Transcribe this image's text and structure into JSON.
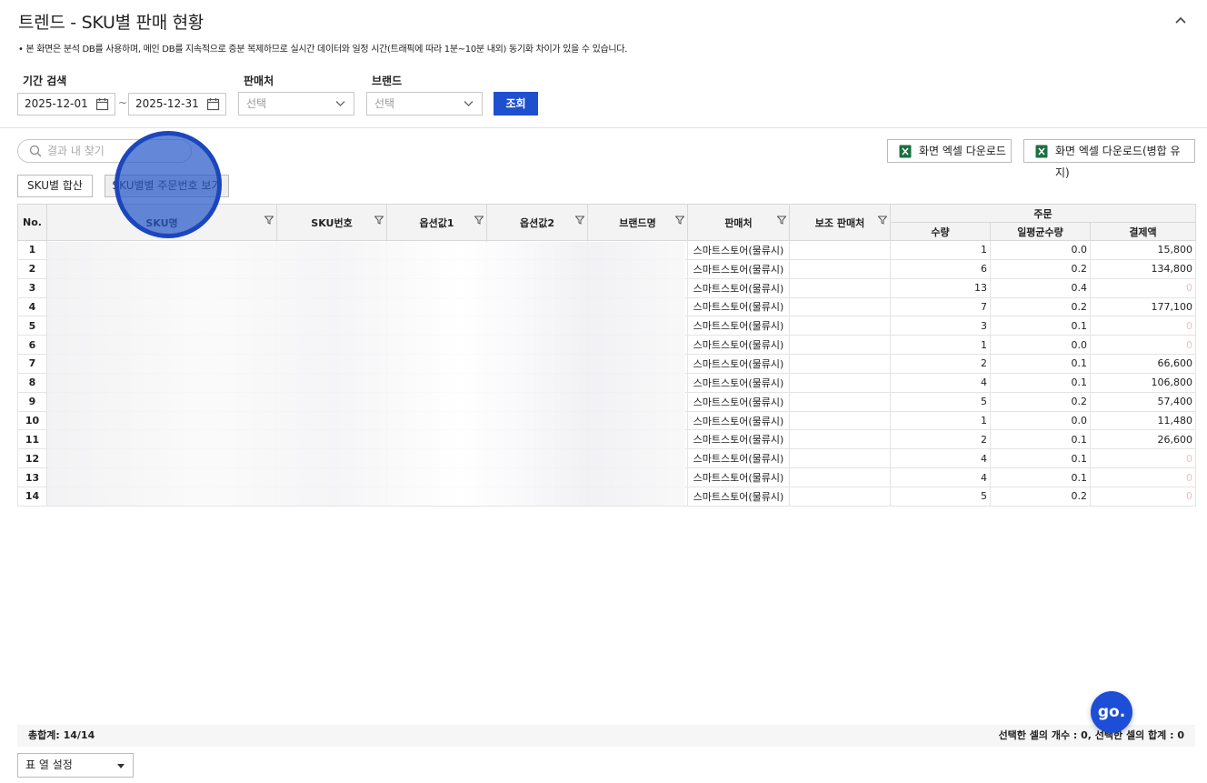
{
  "page": {
    "title": "트렌드 - SKU별 판매 현황",
    "notice": "• 본 화면은 분석 DB를 사용하며, 메인 DB를 지속적으로 증분 복제하므로 실시간 데이터와 일정 시간(트래픽에 따라 1분~10분 내외) 동기화 차이가 있을 수 있습니다."
  },
  "filters": {
    "period_label": "기간 검색",
    "start_date": "2025-12-01",
    "tilde": "~",
    "end_date": "2025-12-31",
    "seller_label": "판매처",
    "seller_value": "선택",
    "brand_label": "브랜드",
    "brand_value": "선택",
    "search_button": "조회"
  },
  "toolbar": {
    "search_placeholder": "결과 내 찾기",
    "excel_download": "화면 엑셀 다운로드",
    "excel_download_merged": "화면 엑셀 다운로드(병합 유지)",
    "view_sum": "SKU별 합산",
    "view_order": "SKU별별 주문번호 보기"
  },
  "table": {
    "headers": {
      "no": "No.",
      "sku_name": "SKU명",
      "sku_no": "SKU번호",
      "option1": "옵션값1",
      "option2": "옵션값2",
      "brand": "브랜드명",
      "seller": "판매처",
      "sub_seller": "보조 판매처",
      "order_group": "주문",
      "qty": "수량",
      "avg_qty": "일평균수량",
      "amount": "결제액"
    },
    "rows": [
      {
        "no": "1",
        "seller": "스마트스토어(물류시)",
        "qty": "1",
        "avg": "0.0",
        "amount": "15,800"
      },
      {
        "no": "2",
        "seller": "스마트스토어(물류시)",
        "qty": "6",
        "avg": "0.2",
        "amount": "134,800"
      },
      {
        "no": "3",
        "seller": "스마트스토어(물류시)",
        "qty": "13",
        "avg": "0.4",
        "amount": "0"
      },
      {
        "no": "4",
        "seller": "스마트스토어(물류시)",
        "qty": "7",
        "avg": "0.2",
        "amount": "177,100"
      },
      {
        "no": "5",
        "seller": "스마트스토어(물류시)",
        "qty": "3",
        "avg": "0.1",
        "amount": "0"
      },
      {
        "no": "6",
        "seller": "스마트스토어(물류시)",
        "qty": "1",
        "avg": "0.0",
        "amount": "0"
      },
      {
        "no": "7",
        "seller": "스마트스토어(물류시)",
        "qty": "2",
        "avg": "0.1",
        "amount": "66,600"
      },
      {
        "no": "8",
        "seller": "스마트스토어(물류시)",
        "qty": "4",
        "avg": "0.1",
        "amount": "106,800"
      },
      {
        "no": "9",
        "seller": "스마트스토어(물류시)",
        "qty": "5",
        "avg": "0.2",
        "amount": "57,400"
      },
      {
        "no": "10",
        "seller": "스마트스토어(물류시)",
        "qty": "1",
        "avg": "0.0",
        "amount": "11,480"
      },
      {
        "no": "11",
        "seller": "스마트스토어(물류시)",
        "qty": "2",
        "avg": "0.1",
        "amount": "26,600"
      },
      {
        "no": "12",
        "seller": "스마트스토어(물류시)",
        "qty": "4",
        "avg": "0.1",
        "amount": "0"
      },
      {
        "no": "13",
        "seller": "스마트스토어(물류시)",
        "qty": "4",
        "avg": "0.1",
        "amount": "0"
      },
      {
        "no": "14",
        "seller": "스마트스토어(물류시)",
        "qty": "5",
        "avg": "0.2",
        "amount": "0"
      }
    ]
  },
  "footer": {
    "total": "총합계: 14/14",
    "selection": "선택한 셀의 개수 : 0, 선택한 셀의 합계 : 0",
    "column_setting": "표 열 설정"
  },
  "fab_label": "go.",
  "colors": {
    "primary": "#1e4fcf",
    "zero_amount": "#f0c0c0"
  }
}
